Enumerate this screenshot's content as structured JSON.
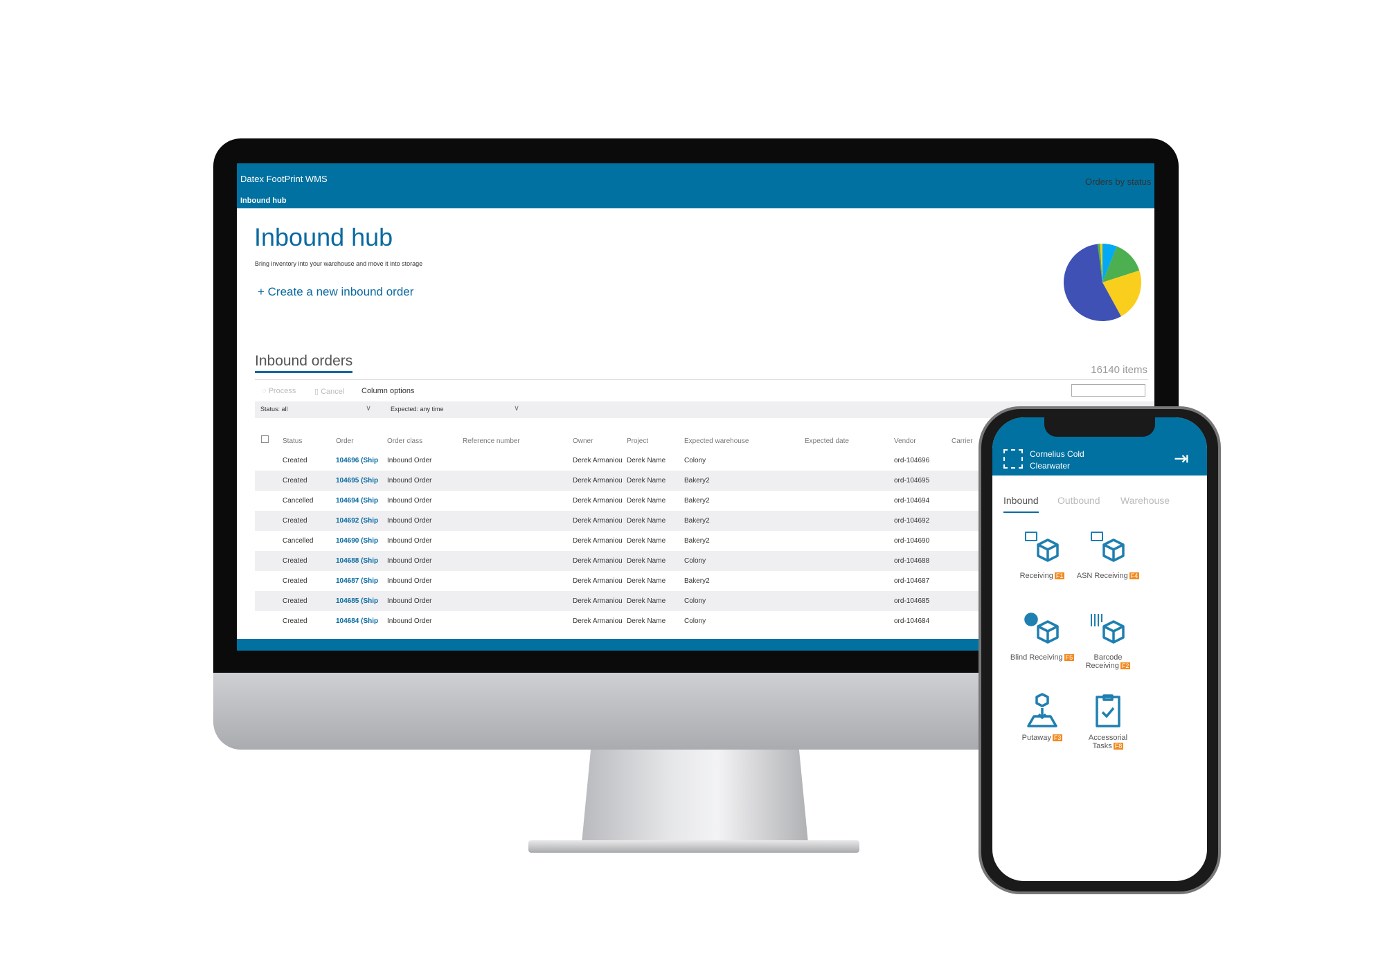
{
  "app": {
    "title": "Datex FootPrint WMS",
    "nav": "Inbound hub"
  },
  "page": {
    "title": "Inbound hub",
    "subtitle": "Bring inventory into your warehouse and move it into storage",
    "create_label": "Create a new inbound order"
  },
  "orders": {
    "title": "Inbound orders",
    "count": "16140 items",
    "toolbar": {
      "process": "Process",
      "cancel": "Cancel",
      "column_options": "Column options"
    },
    "filters": {
      "status": "Status: all",
      "expected": "Expected: any time"
    },
    "columns": [
      "Status",
      "Order",
      "Order class",
      "Reference number",
      "Owner",
      "Project",
      "Expected warehouse",
      "Expected date",
      "Vendor",
      "Carrier"
    ],
    "rows": [
      [
        "Created",
        "104696 (Ship",
        "Inbound Order",
        "",
        "Derek Armaniou",
        "Derek Name",
        "Colony",
        "",
        "ord-104696"
      ],
      [
        "Created",
        "104695 (Ship",
        "Inbound Order",
        "",
        "Derek Armaniou",
        "Derek Name",
        "Bakery2",
        "",
        "ord-104695"
      ],
      [
        "Cancelled",
        "104694 (Ship",
        "Inbound Order",
        "",
        "Derek Armaniou",
        "Derek Name",
        "Bakery2",
        "",
        "ord-104694"
      ],
      [
        "Created",
        "104692 (Ship",
        "Inbound Order",
        "",
        "Derek Armaniou",
        "Derek Name",
        "Bakery2",
        "",
        "ord-104692"
      ],
      [
        "Cancelled",
        "104690 (Ship",
        "Inbound Order",
        "",
        "Derek Armaniou",
        "Derek Name",
        "Bakery2",
        "",
        "ord-104690"
      ],
      [
        "Created",
        "104688 (Ship",
        "Inbound Order",
        "",
        "Derek Armaniou",
        "Derek Name",
        "Colony",
        "",
        "ord-104688"
      ],
      [
        "Created",
        "104687 (Ship",
        "Inbound Order",
        "",
        "Derek Armaniou",
        "Derek Name",
        "Bakery2",
        "",
        "ord-104687"
      ],
      [
        "Created",
        "104685 (Ship",
        "Inbound Order",
        "",
        "Derek Armaniou",
        "Derek Name",
        "Colony",
        "",
        "ord-104685"
      ],
      [
        "Created",
        "104684 (Ship",
        "Inbound Order",
        "",
        "Derek Armaniou",
        "Derek Name",
        "Colony",
        "",
        "ord-104684"
      ]
    ]
  },
  "chart_data": {
    "type": "pie",
    "title": "Orders by status",
    "values": [
      6,
      14,
      22,
      56,
      1,
      1
    ],
    "colors": [
      "#03a9f4",
      "#4caf50",
      "#f9ce1d",
      "#3f51b5",
      "#4caf50",
      "#f9ce1d"
    ]
  },
  "mobile": {
    "site_line1": "Cornelius Cold",
    "site_line2": "Clearwater",
    "tabs": [
      "Inbound",
      "Outbound",
      "Warehouse"
    ],
    "tiles": [
      {
        "label": "Receiving",
        "key": "F1",
        "icon": "receiving-icon"
      },
      {
        "label": "ASN Receiving",
        "key": "F4",
        "icon": "asn-receiving-icon"
      },
      {
        "label": "Blind Receiving",
        "key": "F5",
        "icon": "blind-receiving-icon"
      },
      {
        "label": "Barcode Receiving",
        "key": "F2",
        "icon": "barcode-receiving-icon"
      },
      {
        "label": "Putaway",
        "key": "F3",
        "icon": "putaway-icon"
      },
      {
        "label": "Accessorial Tasks",
        "key": "F8",
        "icon": "accessorial-tasks-icon"
      }
    ]
  },
  "colors": {
    "brand": "#0071a1",
    "accent": "#f28a1e"
  }
}
